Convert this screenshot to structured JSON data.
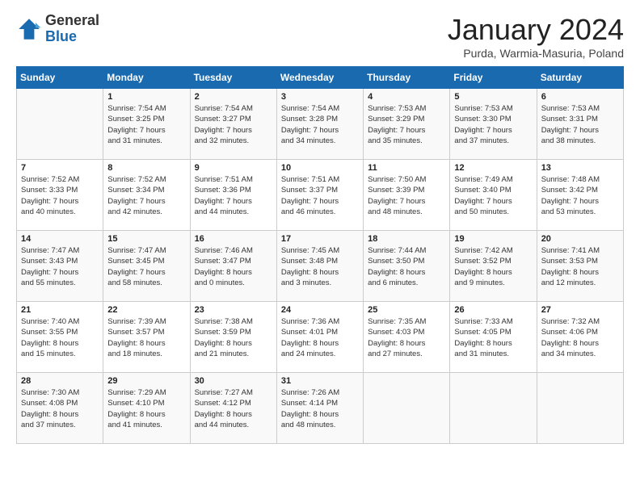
{
  "logo": {
    "general": "General",
    "blue": "Blue"
  },
  "title": "January 2024",
  "location": "Purda, Warmia-Masuria, Poland",
  "days_header": [
    "Sunday",
    "Monday",
    "Tuesday",
    "Wednesday",
    "Thursday",
    "Friday",
    "Saturday"
  ],
  "weeks": [
    [
      {
        "day": "",
        "info": ""
      },
      {
        "day": "1",
        "info": "Sunrise: 7:54 AM\nSunset: 3:25 PM\nDaylight: 7 hours\nand 31 minutes."
      },
      {
        "day": "2",
        "info": "Sunrise: 7:54 AM\nSunset: 3:27 PM\nDaylight: 7 hours\nand 32 minutes."
      },
      {
        "day": "3",
        "info": "Sunrise: 7:54 AM\nSunset: 3:28 PM\nDaylight: 7 hours\nand 34 minutes."
      },
      {
        "day": "4",
        "info": "Sunrise: 7:53 AM\nSunset: 3:29 PM\nDaylight: 7 hours\nand 35 minutes."
      },
      {
        "day": "5",
        "info": "Sunrise: 7:53 AM\nSunset: 3:30 PM\nDaylight: 7 hours\nand 37 minutes."
      },
      {
        "day": "6",
        "info": "Sunrise: 7:53 AM\nSunset: 3:31 PM\nDaylight: 7 hours\nand 38 minutes."
      }
    ],
    [
      {
        "day": "7",
        "info": "Sunrise: 7:52 AM\nSunset: 3:33 PM\nDaylight: 7 hours\nand 40 minutes."
      },
      {
        "day": "8",
        "info": "Sunrise: 7:52 AM\nSunset: 3:34 PM\nDaylight: 7 hours\nand 42 minutes."
      },
      {
        "day": "9",
        "info": "Sunrise: 7:51 AM\nSunset: 3:36 PM\nDaylight: 7 hours\nand 44 minutes."
      },
      {
        "day": "10",
        "info": "Sunrise: 7:51 AM\nSunset: 3:37 PM\nDaylight: 7 hours\nand 46 minutes."
      },
      {
        "day": "11",
        "info": "Sunrise: 7:50 AM\nSunset: 3:39 PM\nDaylight: 7 hours\nand 48 minutes."
      },
      {
        "day": "12",
        "info": "Sunrise: 7:49 AM\nSunset: 3:40 PM\nDaylight: 7 hours\nand 50 minutes."
      },
      {
        "day": "13",
        "info": "Sunrise: 7:48 AM\nSunset: 3:42 PM\nDaylight: 7 hours\nand 53 minutes."
      }
    ],
    [
      {
        "day": "14",
        "info": "Sunrise: 7:47 AM\nSunset: 3:43 PM\nDaylight: 7 hours\nand 55 minutes."
      },
      {
        "day": "15",
        "info": "Sunrise: 7:47 AM\nSunset: 3:45 PM\nDaylight: 7 hours\nand 58 minutes."
      },
      {
        "day": "16",
        "info": "Sunrise: 7:46 AM\nSunset: 3:47 PM\nDaylight: 8 hours\nand 0 minutes."
      },
      {
        "day": "17",
        "info": "Sunrise: 7:45 AM\nSunset: 3:48 PM\nDaylight: 8 hours\nand 3 minutes."
      },
      {
        "day": "18",
        "info": "Sunrise: 7:44 AM\nSunset: 3:50 PM\nDaylight: 8 hours\nand 6 minutes."
      },
      {
        "day": "19",
        "info": "Sunrise: 7:42 AM\nSunset: 3:52 PM\nDaylight: 8 hours\nand 9 minutes."
      },
      {
        "day": "20",
        "info": "Sunrise: 7:41 AM\nSunset: 3:53 PM\nDaylight: 8 hours\nand 12 minutes."
      }
    ],
    [
      {
        "day": "21",
        "info": "Sunrise: 7:40 AM\nSunset: 3:55 PM\nDaylight: 8 hours\nand 15 minutes."
      },
      {
        "day": "22",
        "info": "Sunrise: 7:39 AM\nSunset: 3:57 PM\nDaylight: 8 hours\nand 18 minutes."
      },
      {
        "day": "23",
        "info": "Sunrise: 7:38 AM\nSunset: 3:59 PM\nDaylight: 8 hours\nand 21 minutes."
      },
      {
        "day": "24",
        "info": "Sunrise: 7:36 AM\nSunset: 4:01 PM\nDaylight: 8 hours\nand 24 minutes."
      },
      {
        "day": "25",
        "info": "Sunrise: 7:35 AM\nSunset: 4:03 PM\nDaylight: 8 hours\nand 27 minutes."
      },
      {
        "day": "26",
        "info": "Sunrise: 7:33 AM\nSunset: 4:05 PM\nDaylight: 8 hours\nand 31 minutes."
      },
      {
        "day": "27",
        "info": "Sunrise: 7:32 AM\nSunset: 4:06 PM\nDaylight: 8 hours\nand 34 minutes."
      }
    ],
    [
      {
        "day": "28",
        "info": "Sunrise: 7:30 AM\nSunset: 4:08 PM\nDaylight: 8 hours\nand 37 minutes."
      },
      {
        "day": "29",
        "info": "Sunrise: 7:29 AM\nSunset: 4:10 PM\nDaylight: 8 hours\nand 41 minutes."
      },
      {
        "day": "30",
        "info": "Sunrise: 7:27 AM\nSunset: 4:12 PM\nDaylight: 8 hours\nand 44 minutes."
      },
      {
        "day": "31",
        "info": "Sunrise: 7:26 AM\nSunset: 4:14 PM\nDaylight: 8 hours\nand 48 minutes."
      },
      {
        "day": "",
        "info": ""
      },
      {
        "day": "",
        "info": ""
      },
      {
        "day": "",
        "info": ""
      }
    ]
  ]
}
